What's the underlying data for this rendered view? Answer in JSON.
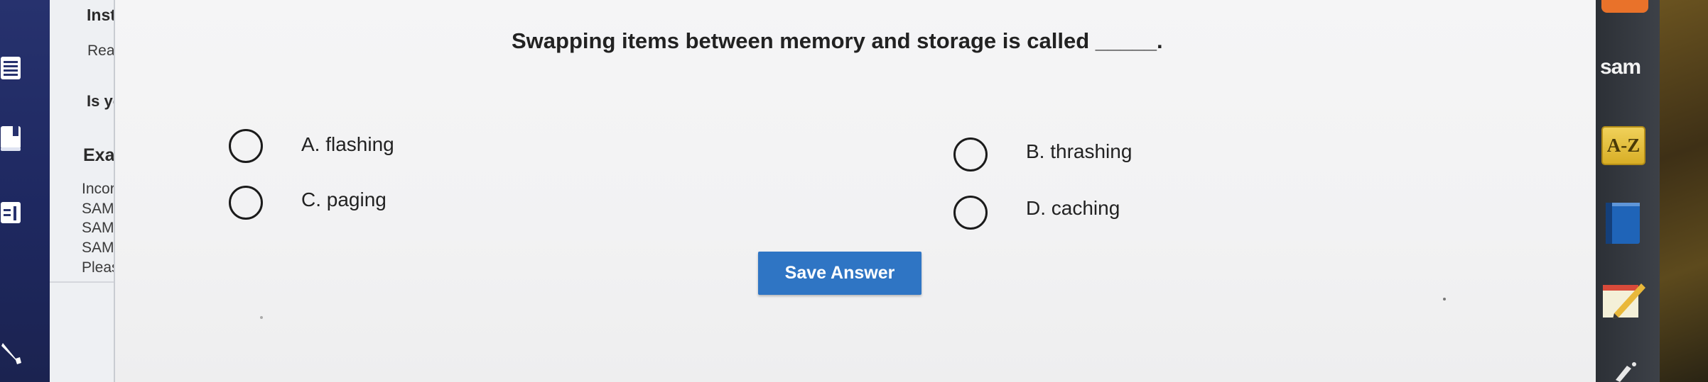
{
  "instructions_panel": {
    "heading": "Instr",
    "read_text": "Read",
    "is_your_text": "Is yo",
    "exam_heading": "Exa",
    "lines": [
      "Incor",
      "SAM",
      "SAM",
      "SAM",
      "Pleas"
    ]
  },
  "question": {
    "text": "Swapping items between memory and storage is called _____.",
    "options": [
      {
        "letter": "A",
        "label": "A. flashing"
      },
      {
        "letter": "B",
        "label": "B. thrashing"
      },
      {
        "letter": "C",
        "label": "C. paging"
      },
      {
        "letter": "D",
        "label": "D. caching"
      }
    ],
    "selected": null
  },
  "save_button": {
    "label": "Save Answer"
  },
  "dock": {
    "sam_logo": "sam",
    "az_label": "A-Z"
  },
  "colors": {
    "nav_bg": "#27326e",
    "button_bg": "#2f75c4",
    "az_gold": "#e2bb35",
    "page_bg": "#f4f4f5"
  },
  "nav_icons": [
    "list-icon",
    "book-icon",
    "panel-icon",
    "wrench-icon"
  ]
}
